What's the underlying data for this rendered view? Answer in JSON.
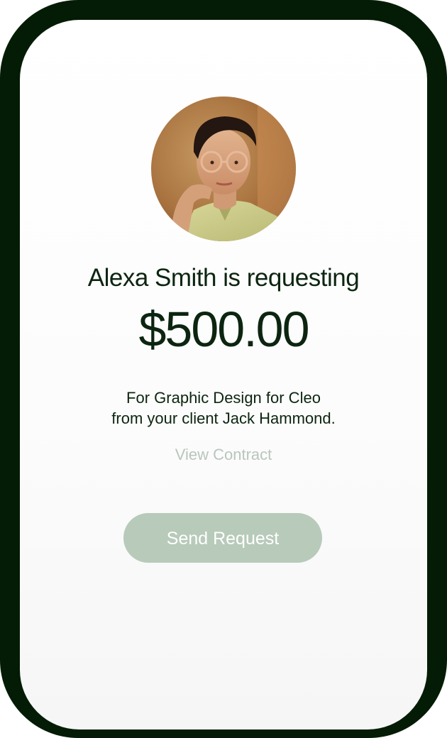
{
  "request": {
    "requester_line": "Alexa Smith is requesting",
    "amount": "$500.00",
    "description_line1": "For Graphic Design for Cleo",
    "description_line2": "from your client Jack Hammond.",
    "view_contract_label": "View Contract",
    "send_button_label": "Send Request"
  },
  "colors": {
    "frame": "#041c05",
    "text_primary": "#0c2510",
    "link_muted": "#b9c6ba",
    "button_bg": "#b8cab9",
    "button_text": "#ffffff"
  }
}
